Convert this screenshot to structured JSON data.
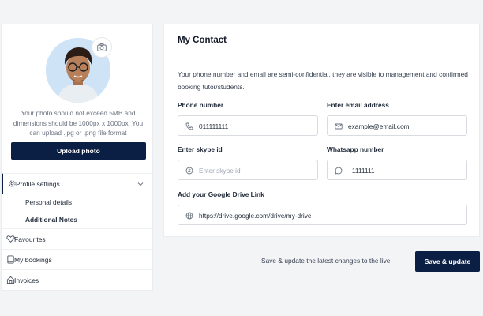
{
  "profile": {
    "photo_note": "Your photo should not exceed 5MB and dimensions should be 1000px x 1000px. You can upload .jpg or .png file format",
    "upload_label": "Upload photo",
    "camera_icon": "camera-icon"
  },
  "sidebar": {
    "profile_settings": "Profile settings",
    "sub_items": [
      {
        "label": "Personal details"
      },
      {
        "label": "Additional Notes"
      }
    ],
    "items": [
      {
        "label": "Favourites",
        "icon": "heart-icon"
      },
      {
        "label": "My bookings",
        "icon": "book-icon"
      },
      {
        "label": "Invoices",
        "icon": "home-icon"
      }
    ]
  },
  "contact": {
    "title": "My Contact",
    "description": "Your phone number and email are semi-confidential, they are visible to management and confirmed booking tutor/students.",
    "phone": {
      "label": "Phone number",
      "value": "011111111",
      "placeholder": ""
    },
    "email": {
      "label": "Enter email address",
      "value": "example@email.com",
      "placeholder": ""
    },
    "skype": {
      "label": "Enter skype id",
      "value": "",
      "placeholder": "Enter skype id"
    },
    "whatsapp": {
      "label": "Whatsapp number",
      "value": "+1111111",
      "placeholder": ""
    },
    "drive": {
      "label": "Add your Google Drive Link",
      "value": "https://drive.google.com/drive/my-drive",
      "placeholder": ""
    }
  },
  "footer": {
    "note": "Save & update the latest changes to the live",
    "save_label": "Save & update"
  },
  "colors": {
    "accent": "#0b1f44",
    "background": "#f3f4f6",
    "card": "#ffffff"
  }
}
